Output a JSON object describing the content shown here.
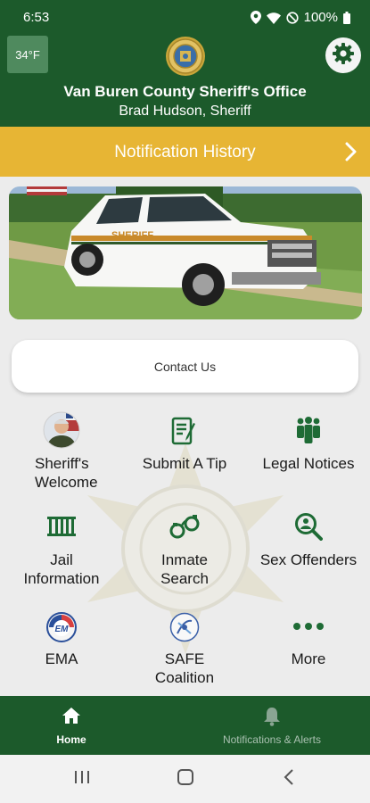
{
  "status_bar": {
    "time": "6:53",
    "battery": "100%"
  },
  "header": {
    "weather": "34°F",
    "title": "Van Buren County Sheriff's Office",
    "subtitle": "Brad Hudson, Sheriff"
  },
  "notification": {
    "label": "Notification History"
  },
  "contact": {
    "label": "Contact Us"
  },
  "grid": [
    {
      "label": "Sheriff's Welcome",
      "icon": "sheriff-portrait"
    },
    {
      "label": "Submit A Tip",
      "icon": "clipboard-pen-icon"
    },
    {
      "label": "Legal Notices",
      "icon": "people-icon"
    },
    {
      "label": "Jail Information",
      "icon": "jail-bars-icon"
    },
    {
      "label": "Inmate Search",
      "icon": "handcuffs-icon"
    },
    {
      "label": "Sex Offenders",
      "icon": "search-person-icon"
    },
    {
      "label": "EMA",
      "icon": "ema-logo"
    },
    {
      "label": "SAFE Coalition",
      "icon": "safe-logo"
    },
    {
      "label": "More",
      "icon": "more-dots-icon"
    }
  ],
  "tabbar": {
    "home": "Home",
    "alerts": "Notifications & Alerts"
  },
  "colors": {
    "primary_green": "#1c5a2b",
    "accent_gold": "#e7b534",
    "icon_green": "#1e6b35"
  }
}
